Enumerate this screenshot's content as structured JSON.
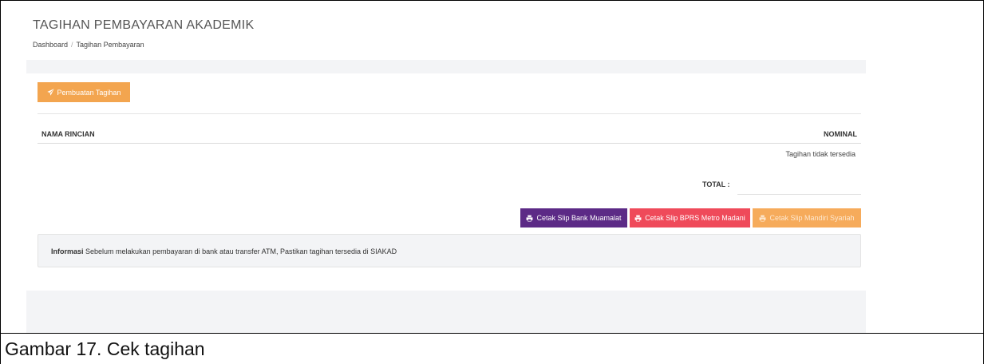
{
  "header": {
    "title": "TAGIHAN PEMBAYARAN AKADEMIK",
    "breadcrumb": [
      "Dashboard",
      "Tagihan Pembayaran"
    ]
  },
  "toolbar": {
    "create_label": "Pembuatan Tagihan",
    "create_icon": "paper-plane-icon"
  },
  "table": {
    "col_name": "NAMA RINCIAN",
    "col_amount": "NOMINAL",
    "empty_message": "Tagihan tidak tersedia",
    "total_label": "TOTAL :"
  },
  "print_buttons": {
    "muamalat": "Cetak Slip Bank Muamalat",
    "bprs": "Cetak Slip BPRS Metro Madani",
    "mandiri": "Cetak Slip Mandiri Syariah",
    "icon": "printer-icon"
  },
  "info": {
    "label": "Informasi",
    "text": "Sebelum melakukan pembayaran di bank atau transfer ATM, Pastikan tagihan tersedia di SIAKAD"
  },
  "colors": {
    "orange": "#f3a54f",
    "purple": "#5c2a86",
    "red": "#ef4a5a"
  },
  "caption": "Gambar 17. Cek tagihan"
}
